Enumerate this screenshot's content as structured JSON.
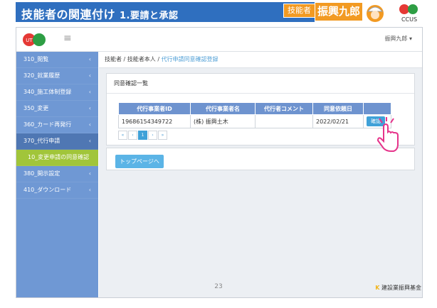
{
  "banner": {
    "title": "技能者の関連付け",
    "subtitle": "1.要請と承認",
    "role": "技能者",
    "name": "振興九郎"
  },
  "topbar": {
    "menu_toggle": "≡",
    "user": "振興九郎 ▾"
  },
  "sidebar": {
    "items": [
      {
        "label": "310_閲覧",
        "chev": "‹"
      },
      {
        "label": "320_就業履歴",
        "chev": "‹"
      },
      {
        "label": "340_施工体制登録",
        "chev": "‹"
      },
      {
        "label": "350_変更",
        "chev": "‹"
      },
      {
        "label": "360_カード再発行",
        "chev": "‹"
      },
      {
        "label": "370_代行申請",
        "chev": "‹"
      },
      {
        "label": "10_変更申請の同意確認",
        "chev": ""
      },
      {
        "label": "380_開示設定",
        "chev": "‹"
      },
      {
        "label": "410_ダウンロード",
        "chev": "‹"
      }
    ]
  },
  "breadcrumb": {
    "items": [
      "技能者",
      "技能者本人",
      "代行申請同意確認登録"
    ]
  },
  "panel": {
    "title": "同意確認一覧",
    "columns": [
      "代行事業者ID",
      "代行事業者名",
      "代行者コメント",
      "同意依頼日",
      ""
    ],
    "rows": [
      [
        "19686154349722",
        "(株) 振興土木",
        "",
        "2022/02/21",
        "確認"
      ]
    ]
  },
  "pager": {
    "first": "«",
    "prev": "‹",
    "current": "1",
    "next": "›",
    "last": "»"
  },
  "actions": {
    "top_page": "トップページへ"
  },
  "footer": {
    "page_number": "23",
    "foundation": "建設業振興基金"
  }
}
